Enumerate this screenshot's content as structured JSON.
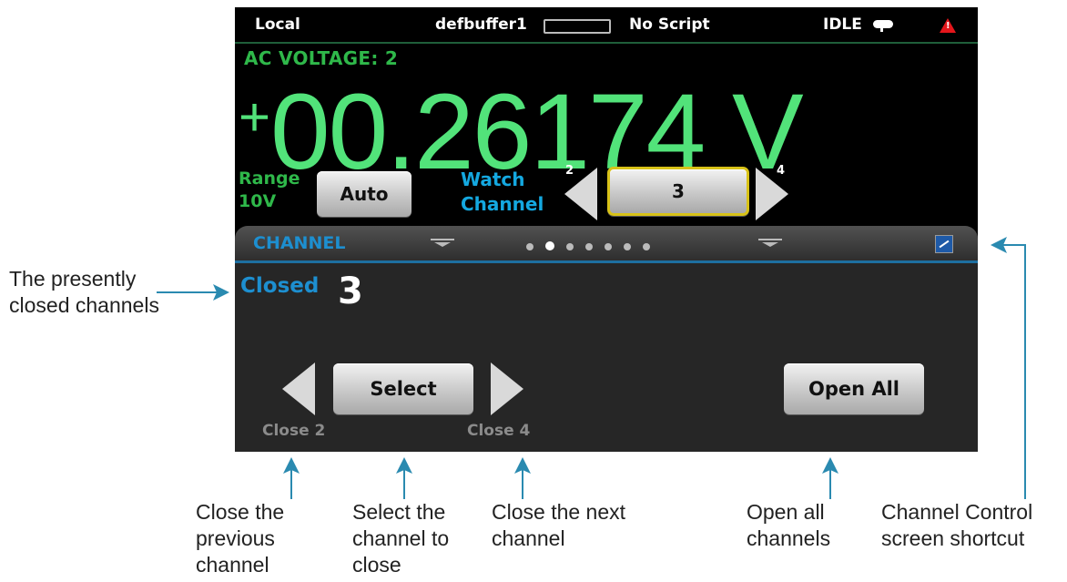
{
  "statusbar": {
    "mode": "Local",
    "buffer": "defbuffer1",
    "script": "No Script",
    "state": "IDLE"
  },
  "measurement": {
    "function_label": "AC VOLTAGE: 2",
    "sign": "+",
    "value": "00.26174 V",
    "color": "#52e37a"
  },
  "range": {
    "label_line1": "Range",
    "label_line2": "10V",
    "button": "Auto"
  },
  "watch": {
    "label_line1": "Watch",
    "label_line2": "Channel",
    "prev": "2",
    "current": "3",
    "next": "4"
  },
  "panel": {
    "title": "CHANNEL",
    "page_count": 7,
    "active_page": 2,
    "accent": "#1d8fd0",
    "closed_label": "Closed",
    "closed_value": "3",
    "select_button": "Select",
    "open_all_button": "Open All",
    "close_prev_label": "Close 2",
    "close_next_label": "Close 4"
  },
  "annotations": {
    "closed_channels": [
      "The presently",
      "closed channels"
    ],
    "close_previous": [
      "Close the",
      "previous",
      "channel"
    ],
    "select_channel": [
      "Select the",
      "channel to",
      "close"
    ],
    "close_next": [
      "Close the next",
      "channel"
    ],
    "open_all": [
      "Open all",
      "channels"
    ],
    "shortcut": [
      "Channel Control",
      "screen shortcut"
    ]
  },
  "icons": {
    "idle": "idle-indicator-icon",
    "warning": "warning-triangle-icon",
    "shortcut": "channel-control-shortcut-icon",
    "arrow_color": "#2a8ab0"
  }
}
